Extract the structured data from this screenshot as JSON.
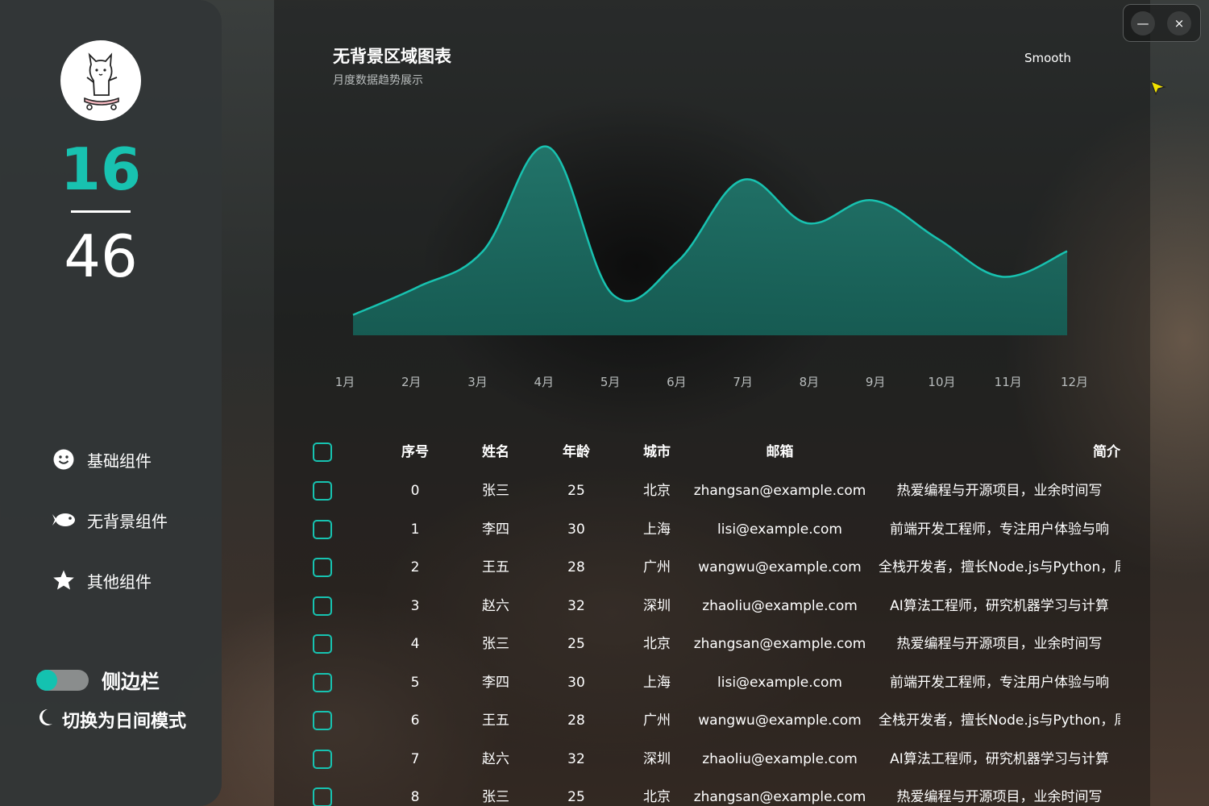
{
  "sidebar": {
    "counter_top": "16",
    "counter_bottom": "46",
    "nav": [
      {
        "label": "基础组件",
        "icon": "smile-icon"
      },
      {
        "label": "无背景组件",
        "icon": "fish-icon"
      },
      {
        "label": "其他组件",
        "icon": "star-icon"
      }
    ],
    "toggle_label": "侧边栏",
    "toggle_on": true,
    "mode_label": "切换为日间模式",
    "mode_icon": "moon-icon"
  },
  "colors": {
    "accent": "#18c2b0",
    "area_fill": "#1f6e65"
  },
  "chart": {
    "title": "无背景区域图表",
    "subtitle": "月度数据趋势展示",
    "mode": "Smooth"
  },
  "chart_data": {
    "type": "area",
    "categories": [
      "1月",
      "2月",
      "3月",
      "4月",
      "5月",
      "6月",
      "7月",
      "8月",
      "9月",
      "10月",
      "11月",
      "12月"
    ],
    "values": [
      8,
      19,
      33,
      74,
      16,
      29,
      61,
      44,
      53,
      38,
      23,
      33
    ],
    "ylim": [
      0,
      100
    ],
    "grid": false,
    "smooth": true
  },
  "table": {
    "headers": [
      "序号",
      "姓名",
      "年龄",
      "城市",
      "邮箱",
      "简介"
    ],
    "rows": [
      {
        "idx": "0",
        "name": "张三",
        "age": "25",
        "city": "北京",
        "email": "zhangsan@example.com",
        "intro": "热爱编程与开源项目，业余时间写"
      },
      {
        "idx": "1",
        "name": "李四",
        "age": "30",
        "city": "上海",
        "email": "lisi@example.com",
        "intro": "前端开发工程师，专注用户体验与响"
      },
      {
        "idx": "2",
        "name": "王五",
        "age": "28",
        "city": "广州",
        "email": "wangwu@example.com",
        "intro": "全栈开发者，擅长Node.js与Python，周"
      },
      {
        "idx": "3",
        "name": "赵六",
        "age": "32",
        "city": "深圳",
        "email": "zhaoliu@example.com",
        "intro": "AI算法工程师，研究机器学习与计算"
      },
      {
        "idx": "4",
        "name": "张三",
        "age": "25",
        "city": "北京",
        "email": "zhangsan@example.com",
        "intro": "热爱编程与开源项目，业余时间写"
      },
      {
        "idx": "5",
        "name": "李四",
        "age": "30",
        "city": "上海",
        "email": "lisi@example.com",
        "intro": "前端开发工程师，专注用户体验与响"
      },
      {
        "idx": "6",
        "name": "王五",
        "age": "28",
        "city": "广州",
        "email": "wangwu@example.com",
        "intro": "全栈开发者，擅长Node.js与Python，周"
      },
      {
        "idx": "7",
        "name": "赵六",
        "age": "32",
        "city": "深圳",
        "email": "zhaoliu@example.com",
        "intro": "AI算法工程师，研究机器学习与计算"
      },
      {
        "idx": "8",
        "name": "张三",
        "age": "25",
        "city": "北京",
        "email": "zhangsan@example.com",
        "intro": "热爱编程与开源项目，业余时间写"
      }
    ]
  },
  "window": {
    "minimize_glyph": "—",
    "close_glyph": "×"
  }
}
